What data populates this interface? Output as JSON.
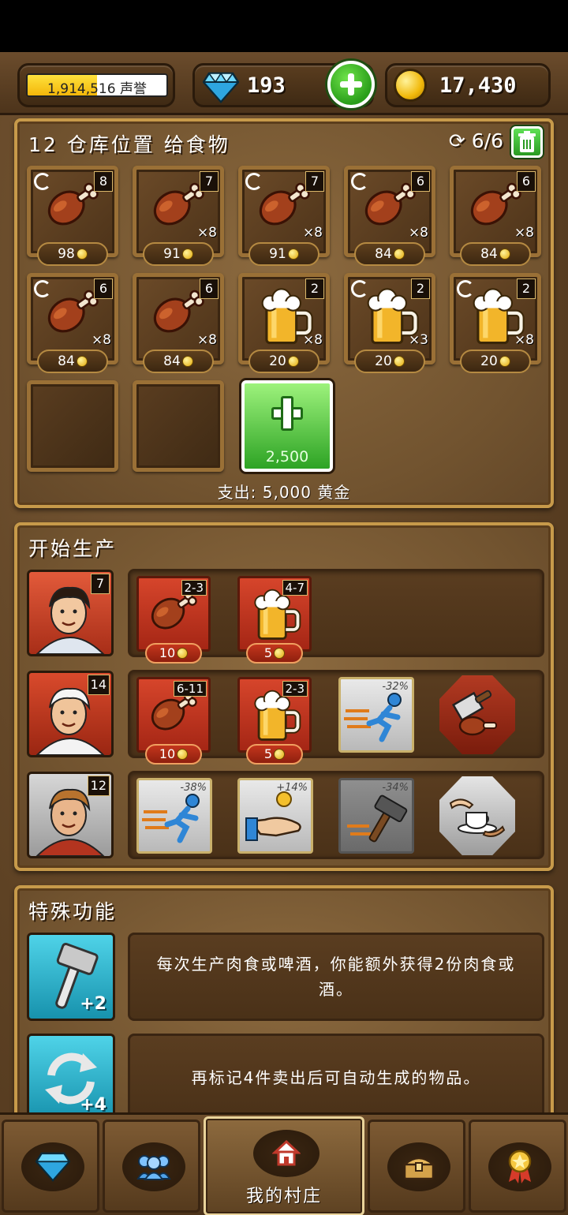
{
  "topbar": {
    "reputation": {
      "value": "1,914,516",
      "unit": "声誉",
      "fill_fraction": 0.5
    },
    "gems": {
      "value": "193",
      "add_icon": "plus-icon"
    },
    "gold": {
      "value": "17,430"
    }
  },
  "storage": {
    "title": "12 仓库位置 给食物",
    "slot_count": "6/6",
    "trash_icon": "trash-icon",
    "items": [
      {
        "kind": "meat",
        "level": "8",
        "qty": "",
        "price": "98",
        "refresh": true
      },
      {
        "kind": "meat",
        "level": "7",
        "qty": "×8",
        "price": "91",
        "refresh": false
      },
      {
        "kind": "meat",
        "level": "7",
        "qty": "×8",
        "price": "91",
        "refresh": true
      },
      {
        "kind": "meat",
        "level": "6",
        "qty": "×8",
        "price": "84",
        "refresh": true
      },
      {
        "kind": "meat",
        "level": "6",
        "qty": "×8",
        "price": "84",
        "refresh": false
      },
      {
        "kind": "meat",
        "level": "6",
        "qty": "×8",
        "price": "84",
        "refresh": true
      },
      {
        "kind": "meat",
        "level": "6",
        "qty": "×8",
        "price": "84",
        "refresh": false
      },
      {
        "kind": "beer",
        "level": "2",
        "qty": "×8",
        "price": "20",
        "refresh": false
      },
      {
        "kind": "beer",
        "level": "2",
        "qty": "×3",
        "price": "20",
        "refresh": true
      },
      {
        "kind": "beer",
        "level": "2",
        "qty": "×8",
        "price": "20",
        "refresh": true
      }
    ],
    "buy_slot_price": "2,500",
    "cost_text": "支出: 5,000 黄金"
  },
  "production": {
    "title": "开始生产",
    "workers": [
      {
        "level": "7",
        "portrait": "barmaid-portrait",
        "items": [
          {
            "kind": "meat",
            "range": "2-3",
            "price": "10"
          },
          {
            "kind": "beer",
            "range": "4-7",
            "price": "5"
          }
        ],
        "skills": []
      },
      {
        "level": "14",
        "portrait": "butcher-portrait",
        "items": [
          {
            "kind": "meat",
            "range": "6-11",
            "price": "10"
          },
          {
            "kind": "beer",
            "range": "2-3",
            "price": "5"
          }
        ],
        "skills": [
          {
            "icon": "running-man-icon",
            "pct": "-32%",
            "style": "gold"
          },
          {
            "icon": "cleaver-meat-icon",
            "pct": "",
            "style": "octo-red"
          }
        ]
      },
      {
        "level": "12",
        "portrait": "lumberjack-portrait",
        "items": [],
        "skills": [
          {
            "icon": "running-man-icon",
            "pct": "-38%",
            "style": "gold"
          },
          {
            "icon": "hand-coin-icon",
            "pct": "+14%",
            "style": "gold"
          },
          {
            "icon": "hammer-icon",
            "pct": "-34%",
            "style": "dark"
          },
          {
            "icon": "serve-tea-icon",
            "pct": "",
            "style": "octo-grey"
          }
        ]
      }
    ]
  },
  "special": {
    "title": "特殊功能",
    "features": [
      {
        "icon": "hammer-icon",
        "bonus": "+2",
        "desc": "每次生产肉食或啤酒，你能额外获得2份肉食或酒。"
      },
      {
        "icon": "refresh-icon",
        "bonus": "+4",
        "desc": "再标记4件卖出后可自动生成的物品。"
      }
    ]
  },
  "nav": {
    "items": [
      {
        "icon": "diamond-icon",
        "label": ""
      },
      {
        "icon": "people-icon",
        "label": ""
      },
      {
        "icon": "home-icon",
        "label": "我的村庄",
        "active": true
      },
      {
        "icon": "treasure-chest-icon",
        "label": ""
      },
      {
        "icon": "medal-icon",
        "label": ""
      }
    ]
  }
}
